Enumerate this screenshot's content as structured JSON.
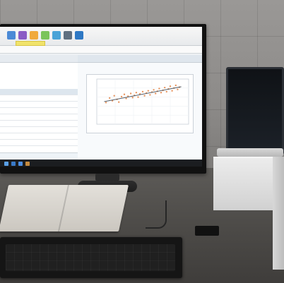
{
  "chart_data": {
    "type": "scatter",
    "title": "",
    "xlabel": "",
    "ylabel": "",
    "xlim": [
      0,
      100
    ],
    "ylim": [
      0,
      100
    ],
    "series": [
      {
        "values": [
          [
            10,
            48
          ],
          [
            14,
            58
          ],
          [
            17,
            52
          ],
          [
            19,
            63
          ],
          [
            22,
            55
          ],
          [
            24,
            49
          ],
          [
            27,
            61
          ],
          [
            30,
            66
          ],
          [
            32,
            57
          ],
          [
            34,
            62
          ],
          [
            37,
            68
          ],
          [
            39,
            59
          ],
          [
            41,
            64
          ],
          [
            43,
            70
          ],
          [
            45,
            60
          ],
          [
            47,
            67
          ],
          [
            50,
            72
          ],
          [
            52,
            63
          ],
          [
            54,
            69
          ],
          [
            56,
            74
          ],
          [
            58,
            65
          ],
          [
            60,
            71
          ],
          [
            62,
            76
          ],
          [
            64,
            68
          ],
          [
            66,
            73
          ],
          [
            68,
            79
          ],
          [
            70,
            70
          ],
          [
            72,
            75
          ],
          [
            74,
            81
          ],
          [
            76,
            72
          ],
          [
            78,
            78
          ],
          [
            80,
            84
          ],
          [
            82,
            74
          ],
          [
            84,
            80
          ],
          [
            86,
            86
          ],
          [
            88,
            77
          ],
          [
            90,
            82
          ]
        ]
      }
    ]
  },
  "colors": {
    "points": "#e5894f",
    "trend": "#55606b"
  }
}
